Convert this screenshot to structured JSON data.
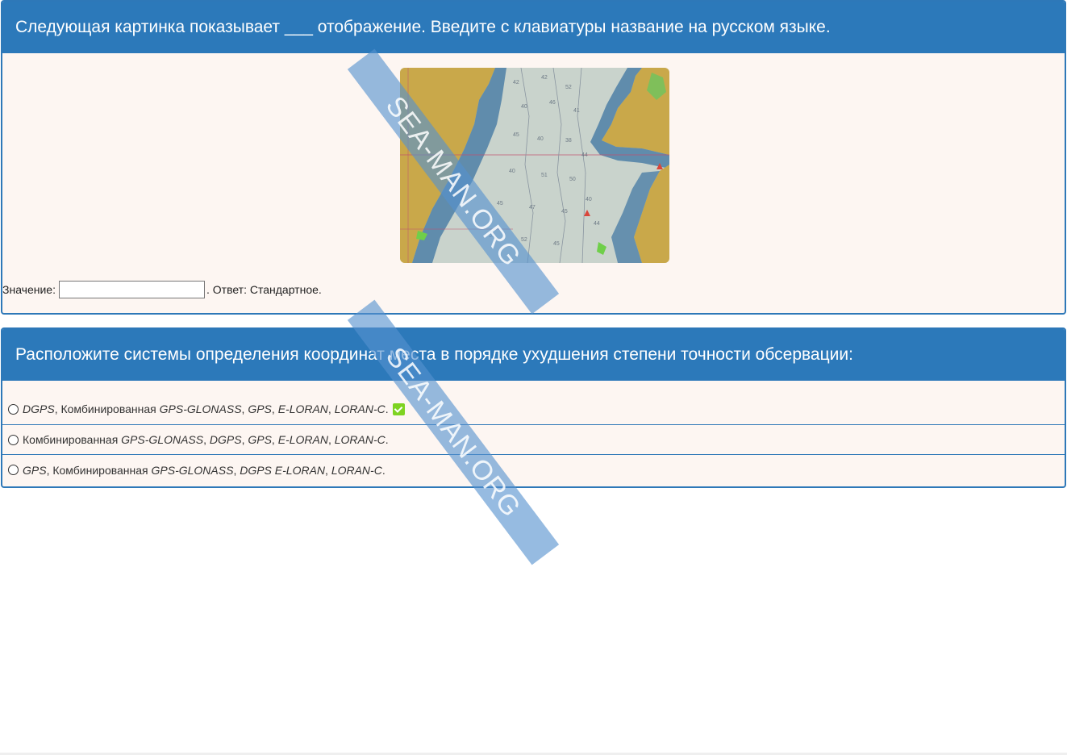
{
  "question1": {
    "title": "Следующая картинка показывает ___ отображение. Введите с клавиатуры название на русском языке.",
    "chart_image_name": "nautical-chart-image",
    "value_label": "Значение:",
    "input_value": "",
    "answer_text": ". Ответ: Стандартное."
  },
  "question2": {
    "title": "Расположите системы определения координат места в порядке ухудшения степени точности обсервации:",
    "options": [
      {
        "parts": [
          [
            "i",
            "DGPS"
          ],
          [
            "n",
            ", Комбинированная "
          ],
          [
            "i",
            "GPS-GLONASS"
          ],
          [
            "n",
            ", "
          ],
          [
            "i",
            "GPS"
          ],
          [
            "n",
            ", "
          ],
          [
            "i",
            "E-LORAN"
          ],
          [
            "n",
            ", "
          ],
          [
            "i",
            "LORAN-C"
          ],
          [
            "n",
            "."
          ]
        ],
        "correct": true
      },
      {
        "parts": [
          [
            "n",
            "Комбинированная "
          ],
          [
            "i",
            "GPS-GLONASS"
          ],
          [
            "n",
            ", "
          ],
          [
            "i",
            "DGPS"
          ],
          [
            "n",
            ", "
          ],
          [
            "i",
            "GPS"
          ],
          [
            "n",
            ", "
          ],
          [
            "i",
            "E-LORAN"
          ],
          [
            "n",
            ", "
          ],
          [
            "i",
            "LORAN-C"
          ],
          [
            "n",
            "."
          ]
        ],
        "correct": false
      },
      {
        "parts": [
          [
            "i",
            "GPS"
          ],
          [
            "n",
            ", Комбинированная "
          ],
          [
            "i",
            "GPS-GLONASS"
          ],
          [
            "n",
            ", "
          ],
          [
            "i",
            "DGPS E-LORAN"
          ],
          [
            "n",
            ", "
          ],
          [
            "i",
            "LORAN-C"
          ],
          [
            "n",
            "."
          ]
        ],
        "correct": false
      }
    ]
  },
  "watermark": "SEA-MAN.ORG",
  "colors": {
    "header": "#2c79ba",
    "card_bg": "#fdf6f2",
    "correct": "#7ed321"
  }
}
